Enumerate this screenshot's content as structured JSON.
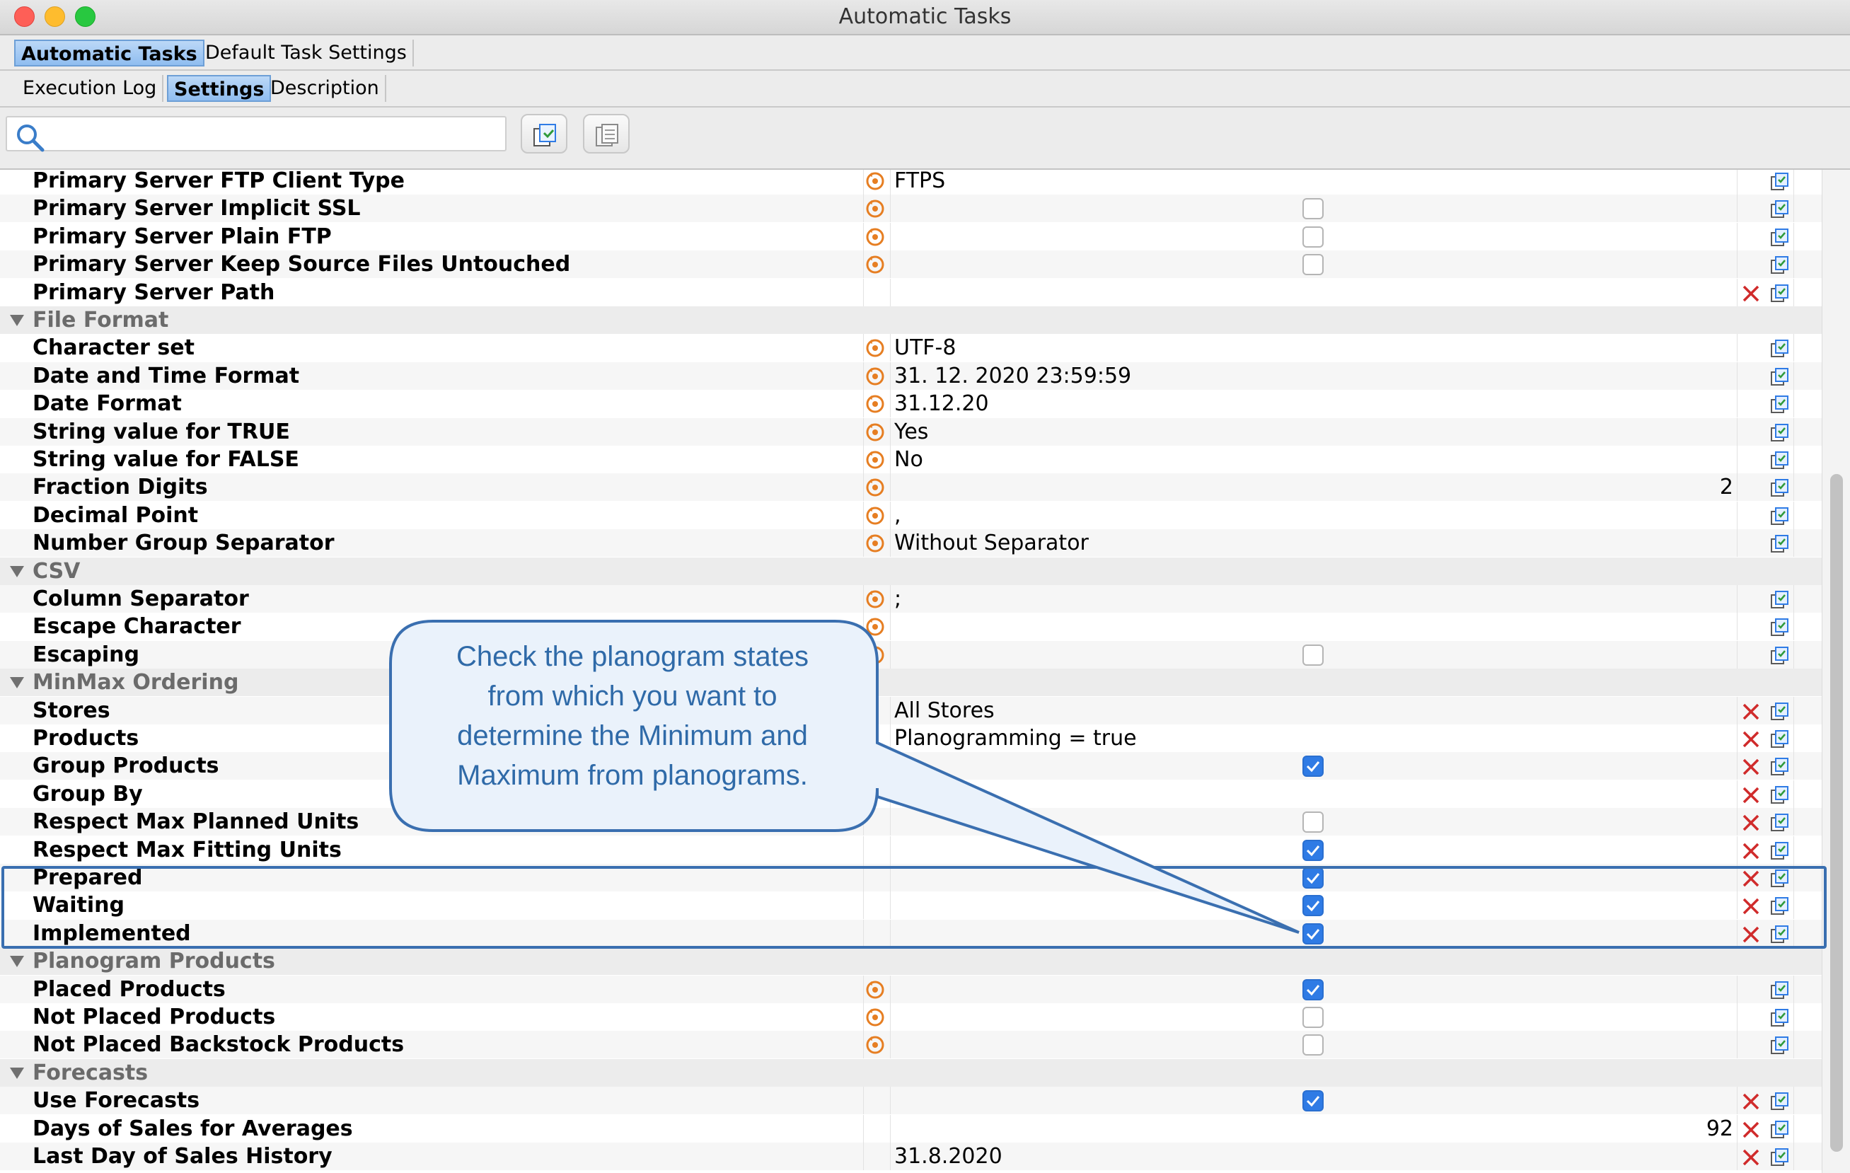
{
  "window": {
    "title": "Automatic Tasks"
  },
  "tabs_primary": [
    {
      "label": "Automatic Tasks",
      "active": true
    },
    {
      "label": "Default Task Settings",
      "active": false
    }
  ],
  "tabs_secondary": [
    {
      "label": "Execution Log",
      "active": false
    },
    {
      "label": "Settings",
      "active": true
    },
    {
      "label": "Description",
      "active": false
    }
  ],
  "toolbar": {
    "search_value": "",
    "search_placeholder": ""
  },
  "icons": {
    "default": "orange-circle-icon",
    "remove": "red-x-icon",
    "edit": "edit-icon",
    "checked": "checkbox-checked",
    "unchecked": "checkbox-unchecked"
  },
  "colors": {
    "accent": "#2f7be5",
    "callout_text": "#2f6aa8",
    "callout_border": "#3a6fb0",
    "callout_fill": "#eaf2fb",
    "remove": "#d02b2b",
    "default_icon": "#e67e22"
  },
  "rows": [
    {
      "type": "setting",
      "name": "Primary Server FTP Client Type",
      "default_icon": true,
      "value": "FTPS"
    },
    {
      "type": "setting",
      "name": "Primary Server Implicit SSL",
      "default_icon": true,
      "checkbox": "unchecked"
    },
    {
      "type": "setting",
      "name": "Primary Server Plain FTP",
      "default_icon": true,
      "checkbox": "unchecked"
    },
    {
      "type": "setting",
      "name": "Primary Server Keep Source Files Untouched",
      "default_icon": true,
      "checkbox": "unchecked"
    },
    {
      "type": "setting",
      "name": "Primary Server Path",
      "remove": true
    },
    {
      "type": "group",
      "name": "File Format"
    },
    {
      "type": "setting",
      "name": "Character set",
      "default_icon": true,
      "value": "UTF-8"
    },
    {
      "type": "setting",
      "name": "Date and Time Format",
      "default_icon": true,
      "value": "31. 12. 2020 23:59:59"
    },
    {
      "type": "setting",
      "name": "Date Format",
      "default_icon": true,
      "value": "31.12.20"
    },
    {
      "type": "setting",
      "name": "String value for TRUE",
      "default_icon": true,
      "value": "Yes"
    },
    {
      "type": "setting",
      "name": "String value for FALSE",
      "default_icon": true,
      "value": "No"
    },
    {
      "type": "setting",
      "name": "Fraction Digits",
      "default_icon": true,
      "number": "2"
    },
    {
      "type": "setting",
      "name": "Decimal Point",
      "default_icon": true,
      "value": ","
    },
    {
      "type": "setting",
      "name": "Number Group Separator",
      "default_icon": true,
      "value": "Without Separator"
    },
    {
      "type": "group",
      "name": "CSV"
    },
    {
      "type": "setting",
      "name": "Column Separator",
      "default_icon": true,
      "value": ";"
    },
    {
      "type": "setting",
      "name": "Escape Character",
      "default_icon": true
    },
    {
      "type": "setting",
      "name": "Escaping",
      "default_icon": true,
      "checkbox": "unchecked"
    },
    {
      "type": "group",
      "name": "MinMax Ordering"
    },
    {
      "type": "setting",
      "name": "Stores",
      "value": "All Stores",
      "remove": true
    },
    {
      "type": "setting",
      "name": "Products",
      "value": "Planogramming = true",
      "remove": true
    },
    {
      "type": "setting",
      "name": "Group Products",
      "checkbox": "checked",
      "remove": true
    },
    {
      "type": "setting",
      "name": "Group By",
      "remove": true
    },
    {
      "type": "setting",
      "name": "Respect Max Planned Units",
      "checkbox": "unchecked",
      "remove": true
    },
    {
      "type": "setting",
      "name": "Respect Max Fitting Units",
      "checkbox": "checked",
      "remove": true
    },
    {
      "type": "setting",
      "name": "Prepared",
      "checkbox": "checked",
      "remove": true
    },
    {
      "type": "setting",
      "name": "Waiting",
      "checkbox": "checked",
      "remove": true
    },
    {
      "type": "setting",
      "name": "Implemented",
      "checkbox": "checked",
      "remove": true
    },
    {
      "type": "group",
      "name": "Planogram Products"
    },
    {
      "type": "setting",
      "name": "Placed Products",
      "default_icon": true,
      "checkbox": "checked"
    },
    {
      "type": "setting",
      "name": "Not Placed Products",
      "default_icon": true,
      "checkbox": "unchecked"
    },
    {
      "type": "setting",
      "name": "Not Placed Backstock Products",
      "default_icon": true,
      "checkbox": "unchecked"
    },
    {
      "type": "group",
      "name": "Forecasts"
    },
    {
      "type": "setting",
      "name": "Use Forecasts",
      "checkbox": "checked",
      "remove": true
    },
    {
      "type": "setting",
      "name": "Days of Sales for Averages",
      "number": "92",
      "remove": true
    },
    {
      "type": "setting",
      "name": "Last Day of Sales History",
      "value": "31.8.2020",
      "remove": true
    }
  ],
  "callout": {
    "text_lines": [
      "Check the planogram states",
      "from which you want to",
      "determine the Minimum and",
      "Maximum from planograms."
    ]
  }
}
